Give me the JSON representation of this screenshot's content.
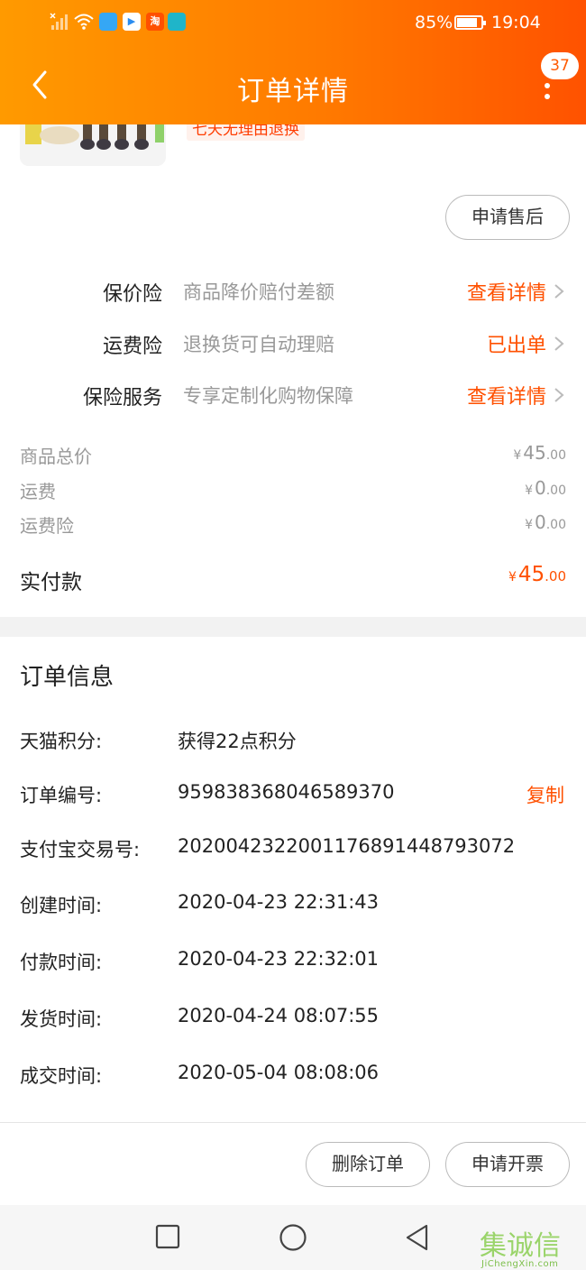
{
  "status_bar": {
    "battery_percent": "85%",
    "battery_level": 0.85,
    "time": "19:04",
    "app_icons": [
      {
        "name": "bulb-app-icon",
        "color": "#35a7f5",
        "glyph": ""
      },
      {
        "name": "youku-app-icon",
        "color": "#ffffff",
        "glyph": "▶"
      },
      {
        "name": "taobao-app-icon",
        "color": "#ff5000",
        "glyph": "淘"
      },
      {
        "name": "book-app-icon",
        "color": "#1fb5c9",
        "glyph": ""
      }
    ]
  },
  "header": {
    "title": "订单详情",
    "badge_count": "37"
  },
  "product": {
    "promo_tag": "七天无理由退换"
  },
  "after_sales_button": "申请售后",
  "insurance": [
    {
      "label": "保价险",
      "desc": "商品降价赔付差额",
      "action": "查看详情"
    },
    {
      "label": "运费险",
      "desc": "退换货可自动理赔",
      "action": "已出单"
    },
    {
      "label": "保险服务",
      "desc": "专享定制化购物保障",
      "action": "查看详情"
    }
  ],
  "prices": {
    "currency": "¥",
    "rows": [
      {
        "label": "商品总价",
        "int": "45",
        "dec": ".00"
      },
      {
        "label": "运费",
        "int": "0",
        "dec": ".00"
      },
      {
        "label": "运费险",
        "int": "0",
        "dec": ".00"
      }
    ],
    "total_label": "实付款",
    "total_int": "45",
    "total_dec": ".00"
  },
  "order_info": {
    "title": "订单信息",
    "copy_label": "复制",
    "rows": [
      {
        "label": "天猫积分:",
        "value": "获得22点积分"
      },
      {
        "label": "订单编号:",
        "value": "959838368046589370"
      },
      {
        "label": "支付宝交易号:",
        "value": "2020042322001176891448793072"
      },
      {
        "label": "创建时间:",
        "value": "2020-04-23 22:31:43"
      },
      {
        "label": "付款时间:",
        "value": "2020-04-23 22:32:01"
      },
      {
        "label": "发货时间:",
        "value": "2020-04-24 08:07:55"
      },
      {
        "label": "成交时间:",
        "value": "2020-05-04 08:08:06"
      }
    ]
  },
  "footer": {
    "delete_order": "删除订单",
    "request_invoice": "申请开票"
  },
  "watermark": {
    "chars": "集诚信",
    "url": "JiChengXin.com"
  },
  "colors": {
    "accent": "#ff5000",
    "header_start": "#ff9a00",
    "header_end": "#ff5200"
  }
}
